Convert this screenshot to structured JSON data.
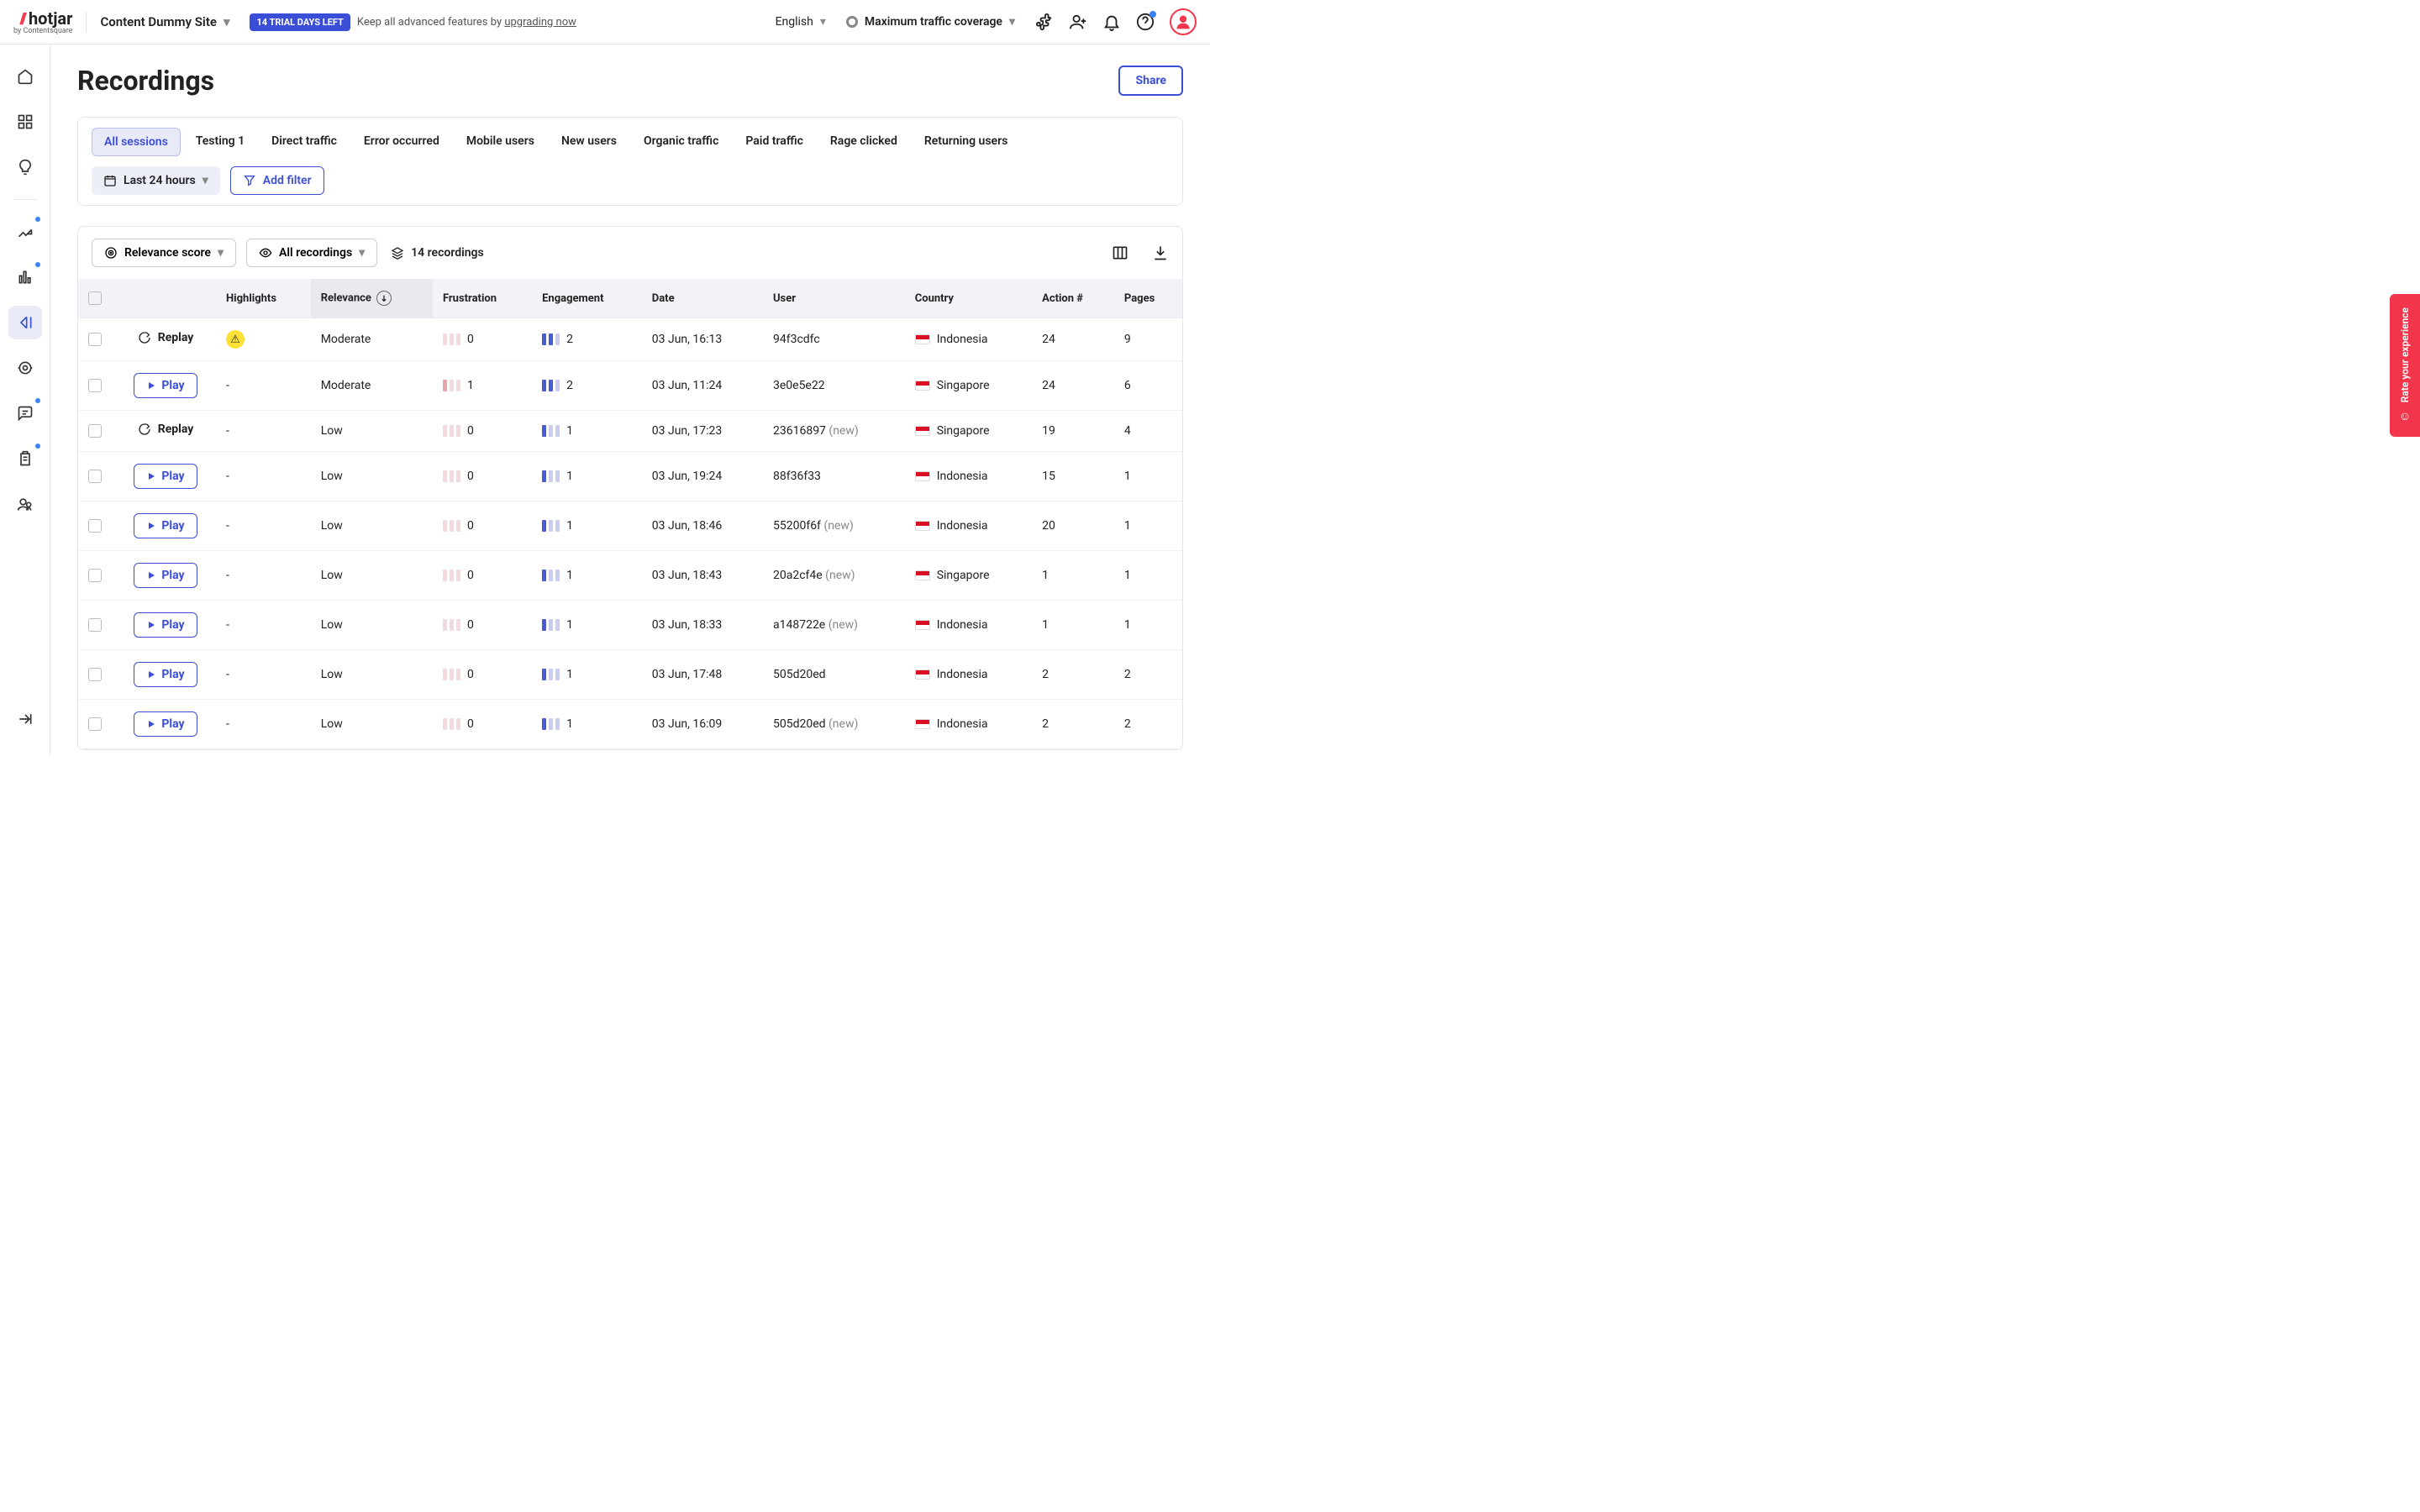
{
  "header": {
    "logo_text": "hotjar",
    "logo_sub": "by Contentsquare",
    "site_name": "Content Dummy Site",
    "trial_badge": "14 TRIAL DAYS LEFT",
    "trial_text": "Keep all advanced features by ",
    "trial_link": "upgrading now",
    "language": "English",
    "traffic": "Maximum traffic coverage"
  },
  "page": {
    "title": "Recordings",
    "share": "Share"
  },
  "segments": [
    "All sessions",
    "Testing 1",
    "Direct traffic",
    "Error occurred",
    "Mobile users",
    "New users",
    "Organic traffic",
    "Paid traffic",
    "Rage clicked",
    "Returning users"
  ],
  "filters": {
    "date_range": "Last 24 hours",
    "add_filter": "Add filter"
  },
  "toolbar": {
    "sort": "Relevance score",
    "view": "All recordings",
    "count": "14 recordings"
  },
  "columns": [
    "",
    "",
    "Highlights",
    "Relevance",
    "Frustration",
    "Engagement",
    "Date",
    "User",
    "Country",
    "Action #",
    "Pages"
  ],
  "labels": {
    "play": "Play",
    "replay": "Replay"
  },
  "rows": [
    {
      "watched": true,
      "highlight": "warn",
      "relevance": "Moderate",
      "frustration": 0,
      "fr_bars": 0,
      "engagement": 2,
      "en_bars": 2,
      "date": "03 Jun, 16:13",
      "user": "94f3cdfc",
      "is_new": false,
      "country": "Indonesia",
      "flag": "id",
      "actions": "24",
      "pages": "9"
    },
    {
      "watched": false,
      "highlight": "-",
      "relevance": "Moderate",
      "frustration": 1,
      "fr_bars": 1,
      "engagement": 2,
      "en_bars": 2,
      "date": "03 Jun, 11:24",
      "user": "3e0e5e22",
      "is_new": false,
      "country": "Singapore",
      "flag": "sg",
      "actions": "24",
      "pages": "6"
    },
    {
      "watched": true,
      "highlight": "-",
      "relevance": "Low",
      "frustration": 0,
      "fr_bars": 0,
      "engagement": 1,
      "en_bars": 1,
      "date": "03 Jun, 17:23",
      "user": "23616897",
      "is_new": true,
      "country": "Singapore",
      "flag": "sg",
      "actions": "19",
      "pages": "4"
    },
    {
      "watched": false,
      "highlight": "-",
      "relevance": "Low",
      "frustration": 0,
      "fr_bars": 0,
      "engagement": 1,
      "en_bars": 1,
      "date": "03 Jun, 19:24",
      "user": "88f36f33",
      "is_new": false,
      "country": "Indonesia",
      "flag": "id",
      "actions": "15",
      "pages": "1"
    },
    {
      "watched": false,
      "highlight": "-",
      "relevance": "Low",
      "frustration": 0,
      "fr_bars": 0,
      "engagement": 1,
      "en_bars": 1,
      "date": "03 Jun, 18:46",
      "user": "55200f6f",
      "is_new": true,
      "country": "Indonesia",
      "flag": "id",
      "actions": "20",
      "pages": "1"
    },
    {
      "watched": false,
      "highlight": "-",
      "relevance": "Low",
      "frustration": 0,
      "fr_bars": 0,
      "engagement": 1,
      "en_bars": 1,
      "date": "03 Jun, 18:43",
      "user": "20a2cf4e",
      "is_new": true,
      "country": "Singapore",
      "flag": "sg",
      "actions": "1",
      "pages": "1"
    },
    {
      "watched": false,
      "highlight": "-",
      "relevance": "Low",
      "frustration": 0,
      "fr_bars": 0,
      "engagement": 1,
      "en_bars": 1,
      "date": "03 Jun, 18:33",
      "user": "a148722e",
      "is_new": true,
      "country": "Indonesia",
      "flag": "id",
      "actions": "1",
      "pages": "1"
    },
    {
      "watched": false,
      "highlight": "-",
      "relevance": "Low",
      "frustration": 0,
      "fr_bars": 0,
      "engagement": 1,
      "en_bars": 1,
      "date": "03 Jun, 17:48",
      "user": "505d20ed",
      "is_new": false,
      "country": "Indonesia",
      "flag": "id",
      "actions": "2",
      "pages": "2"
    },
    {
      "watched": false,
      "highlight": "-",
      "relevance": "Low",
      "frustration": 0,
      "fr_bars": 0,
      "engagement": 1,
      "en_bars": 1,
      "date": "03 Jun, 16:09",
      "user": "505d20ed",
      "is_new": true,
      "country": "Indonesia",
      "flag": "id",
      "actions": "2",
      "pages": "2"
    }
  ],
  "feedback": "Rate your experience"
}
